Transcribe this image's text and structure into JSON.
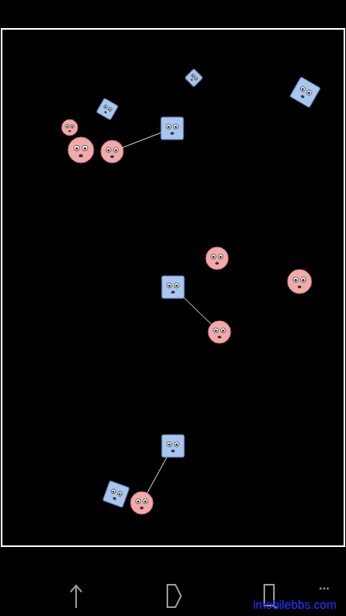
{
  "bodies": [
    {
      "kind": "circle"
    },
    {
      "kind": "circle"
    },
    {
      "kind": "circle"
    },
    {
      "kind": "circle"
    },
    {
      "kind": "circle"
    },
    {
      "kind": "circle"
    },
    {
      "kind": "circle"
    },
    {
      "kind": "box"
    },
    {
      "kind": "box"
    },
    {
      "kind": "box"
    },
    {
      "kind": "box"
    },
    {
      "kind": "box"
    },
    {
      "kind": "box"
    },
    {
      "kind": "box"
    }
  ],
  "joints": [
    {
      "from": 10,
      "to": 2
    },
    {
      "from": 11,
      "to": 5
    },
    {
      "from": 12,
      "to": 6
    }
  ],
  "navigation": {
    "menu": "..."
  },
  "watermark": "imobilebbs.com"
}
